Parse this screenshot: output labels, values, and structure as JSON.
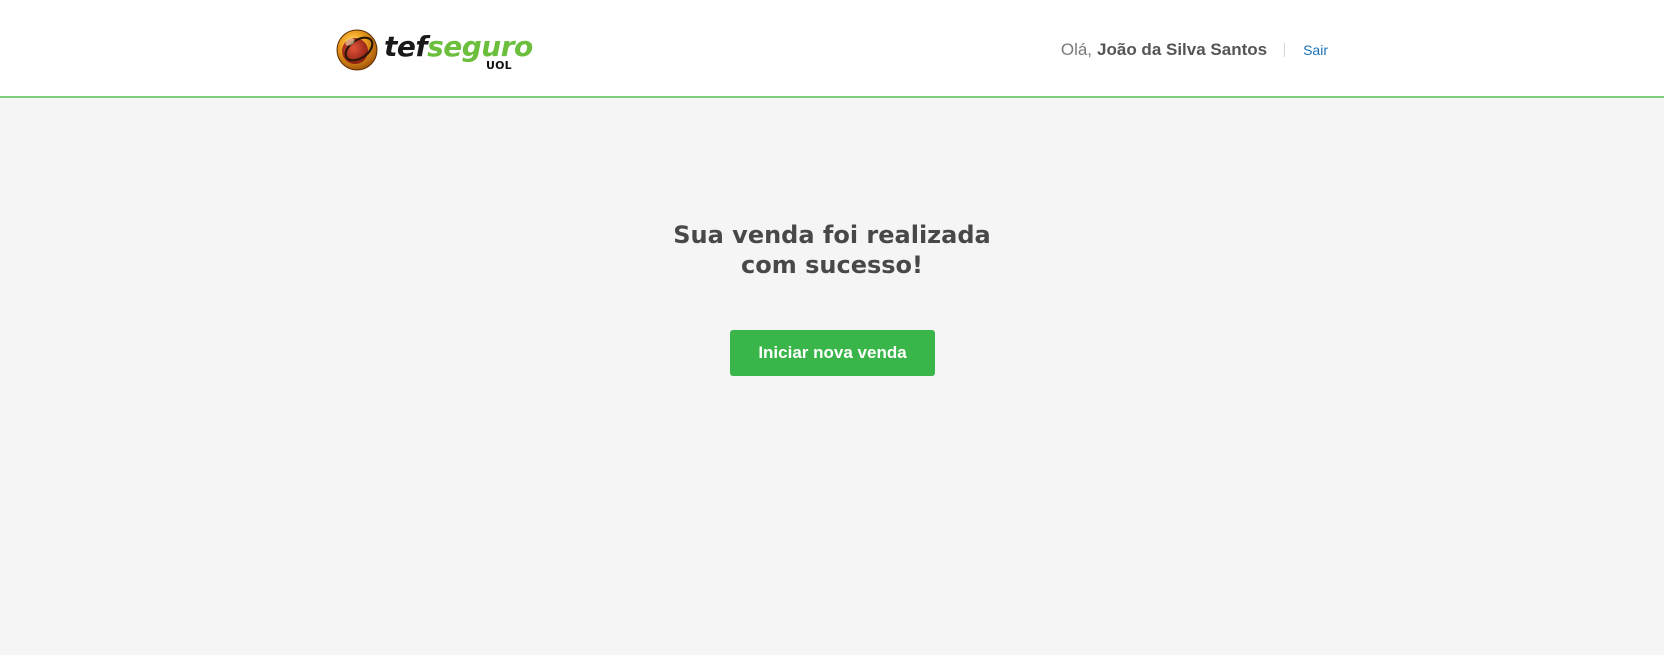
{
  "header": {
    "brand": {
      "wordmark_part1": "tef",
      "wordmark_part2": "seguro",
      "sublabel": "UOL",
      "colors": {
        "wordmark_dark": "#1a1a1a",
        "wordmark_green": "#6cbf3d",
        "logo_orange": "#f0a21f",
        "logo_red": "#c0392b"
      }
    },
    "greeting": "Olá,",
    "user_name": "João da Silva Santos",
    "logout_label": "Sair",
    "logout_color": "#1a73b8",
    "border_color": "#7ccf7c"
  },
  "main": {
    "title_line1": "Sua venda foi realizada",
    "title_line2": "com sucesso!",
    "primary_button_label": "Iniciar nova venda",
    "primary_button_color": "#3ab549",
    "background_color": "#f5f5f5"
  },
  "icons": {
    "logo": "uol-logo-icon"
  }
}
